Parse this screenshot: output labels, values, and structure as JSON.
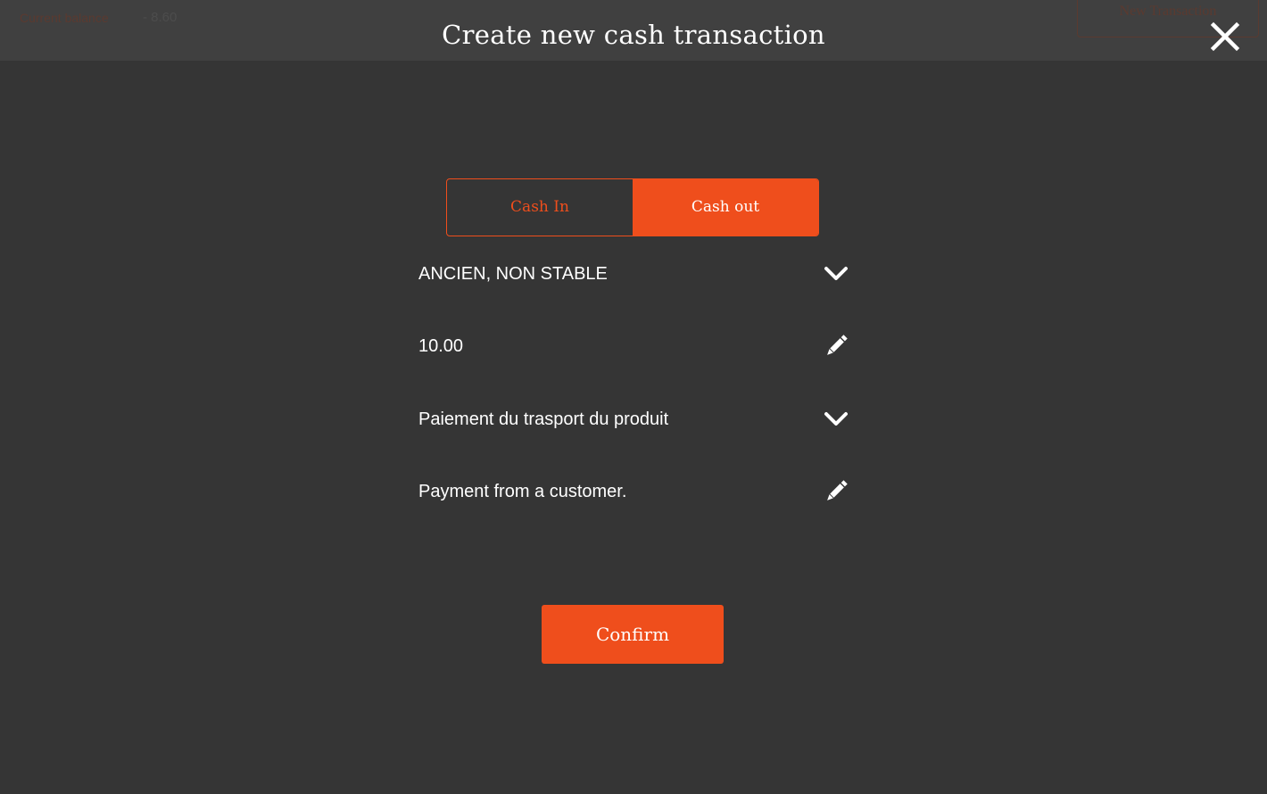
{
  "background": {
    "balance_label": "Current balance",
    "balance_value": "- 8.60",
    "new_transaction_label": "New Transaction"
  },
  "modal": {
    "title": "Create new cash transaction",
    "close_icon": "close-icon"
  },
  "transaction_type": {
    "options": [
      "Cash In",
      "Cash out"
    ],
    "selected": "Cash out"
  },
  "fields": {
    "product": {
      "value": "ANCIEN, NON STABLE",
      "icon": "chevron-down-icon"
    },
    "amount": {
      "value": "10.00",
      "icon": "pencil-icon"
    },
    "reason": {
      "value": "Paiement du trasport du produit",
      "icon": "chevron-down-icon"
    },
    "comment": {
      "value": "Payment from a customer.",
      "icon": "pencil-icon"
    }
  },
  "confirm_label": "Confirm",
  "colors": {
    "accent": "#ef4e1c",
    "background": "#353535",
    "header": "#404040",
    "text": "#ffffff"
  }
}
